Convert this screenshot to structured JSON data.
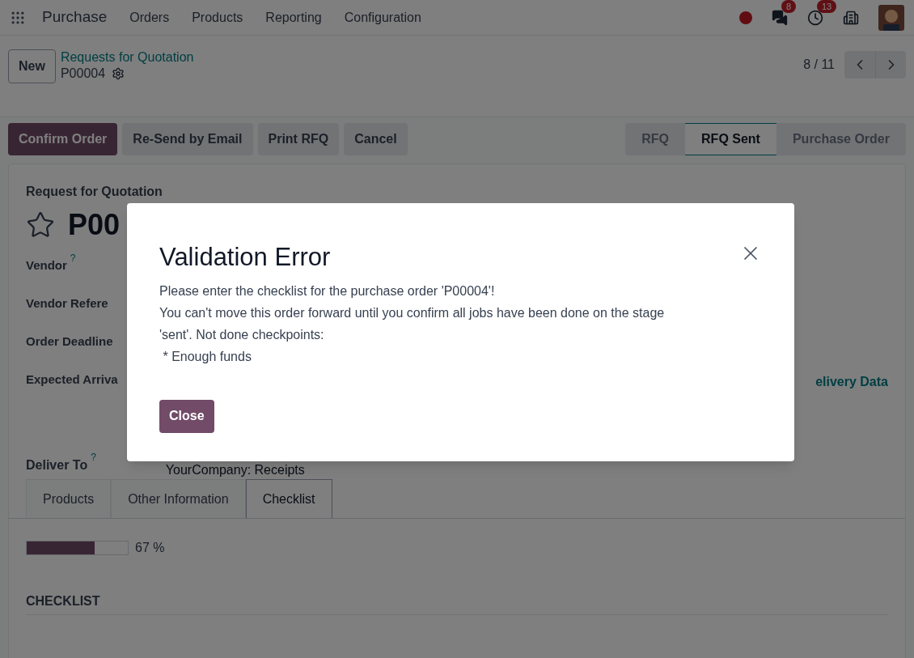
{
  "navbar": {
    "app": "Purchase",
    "menus": [
      "Orders",
      "Products",
      "Reporting",
      "Configuration"
    ],
    "messages_count": "8",
    "activities_count": "13"
  },
  "control_panel": {
    "new_button": "New",
    "breadcrumb": "Requests for Quotation",
    "record": "P00004",
    "pager": "8 / 11"
  },
  "actions": [
    {
      "label": "Confirm Order",
      "kind": "primary"
    },
    {
      "label": "Re-Send by Email",
      "kind": "secondary"
    },
    {
      "label": "Print RFQ",
      "kind": "secondary"
    },
    {
      "label": "Cancel",
      "kind": "secondary"
    }
  ],
  "stages": [
    {
      "label": "RFQ",
      "selected": false
    },
    {
      "label": "RFQ Sent",
      "selected": true
    },
    {
      "label": "Purchase Order",
      "selected": false
    }
  ],
  "form": {
    "subtitle": "Request for Quotation",
    "title": "P00",
    "starred": false,
    "fields": [
      {
        "label": "Vendor",
        "help": "?"
      },
      {
        "label": "Vendor Refere"
      },
      {
        "label": "Order Deadline"
      },
      {
        "label": "Expected Arriva"
      }
    ],
    "delivery_link": "elivery Data",
    "deliver_to": {
      "label": "Deliver To",
      "help": "?",
      "value": "YourCompany: Receipts"
    },
    "tabs": [
      {
        "label": "Products",
        "selected": false
      },
      {
        "label": "Other Information",
        "selected": false
      },
      {
        "label": "Checklist",
        "selected": true
      }
    ],
    "progress": {
      "level": 0.67,
      "reading": "67 %"
    },
    "section": "CHECKLIST"
  },
  "dialog": {
    "title": "Validation Error",
    "lines": [
      "Please enter the checklist for the purchase order 'P00004'!",
      "You can't move this order forward until you confirm all jobs have been done on the stage 'sent'. Not done checkpoints:",
      " * Enough funds"
    ],
    "button": "Close"
  }
}
